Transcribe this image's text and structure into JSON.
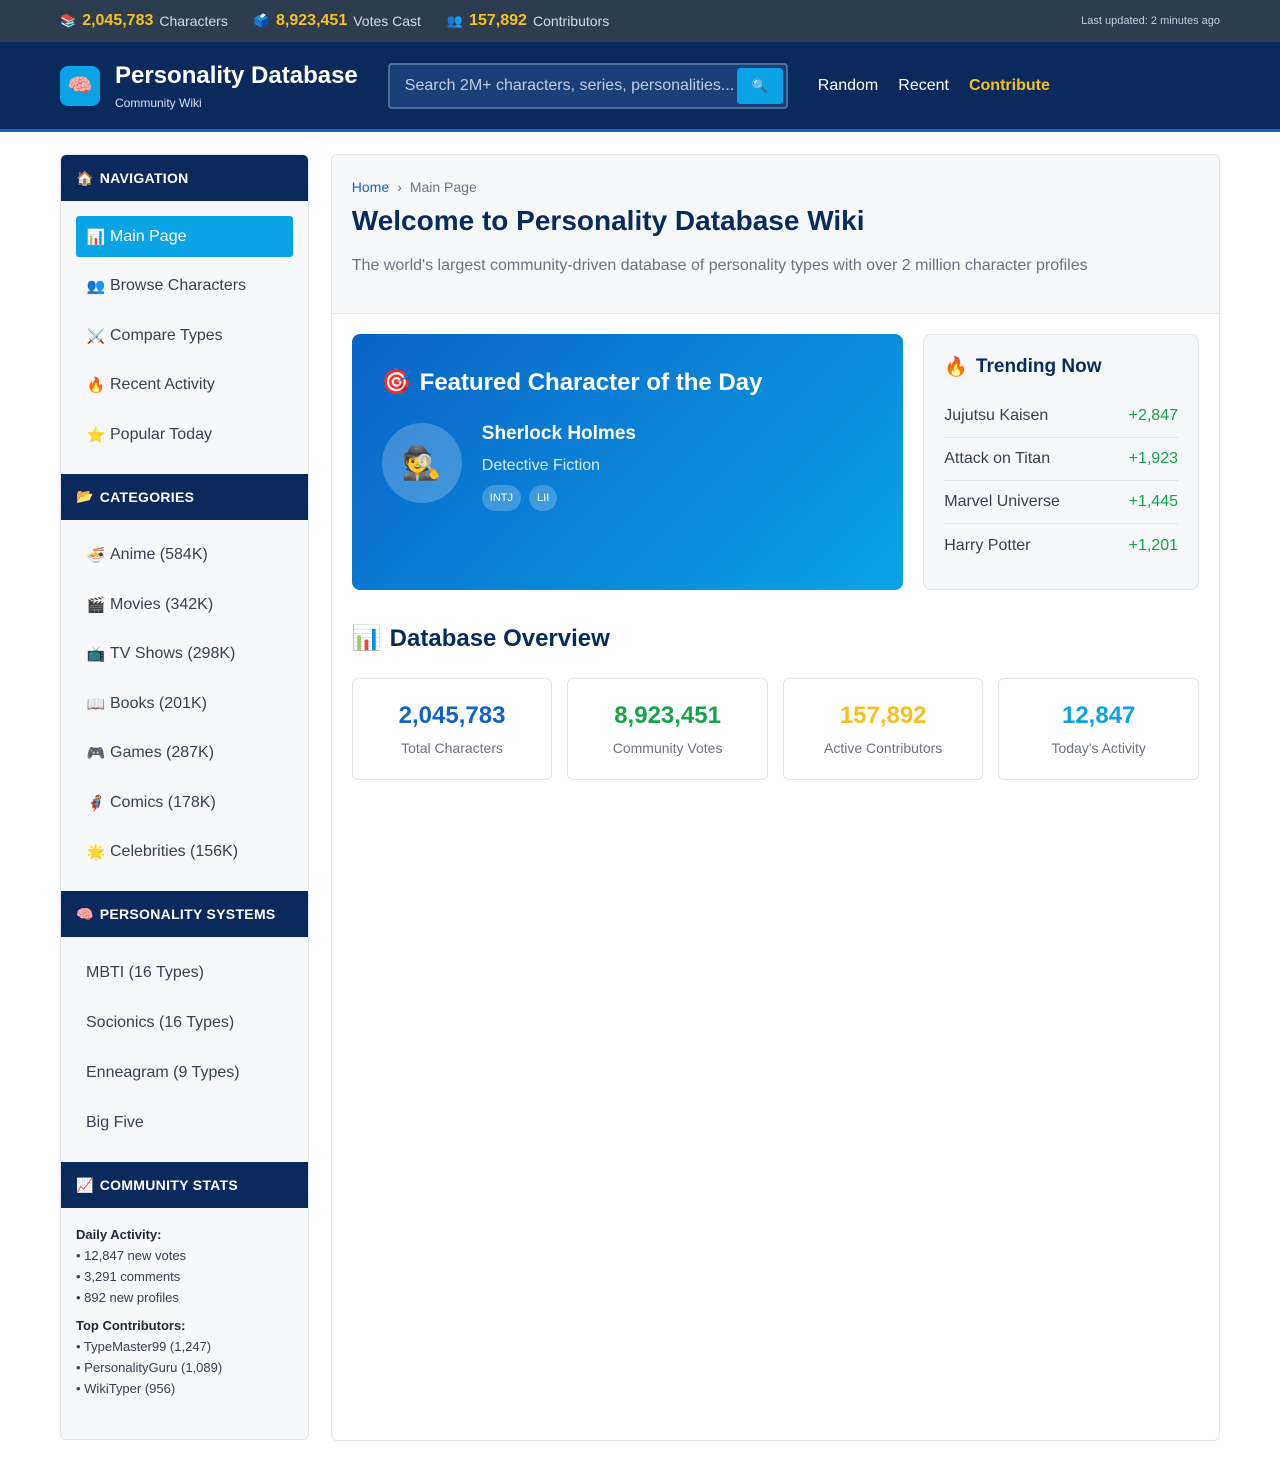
{
  "topbar": {
    "stats": [
      {
        "icon": "books-icon",
        "glyph": "📚",
        "value": "2,045,783",
        "label": "Characters"
      },
      {
        "icon": "ballot-box-icon",
        "glyph": "🗳️",
        "value": "8,923,451",
        "label": "Votes Cast"
      },
      {
        "icon": "people-icon",
        "glyph": "👥",
        "value": "157,892",
        "label": "Contributors"
      }
    ],
    "updated": "Last updated: 2 minutes ago"
  },
  "header": {
    "logo_glyph": "🧠",
    "title": "Personality Database",
    "subtitle": "Community Wiki",
    "search_placeholder": "Search 2M+ characters, series, personalities...",
    "search_button_glyph": "🔍",
    "nav": [
      "Random",
      "Recent",
      "Contribute"
    ]
  },
  "sidebar": {
    "navigation": {
      "title": "NAVIGATION",
      "glyph": "🏠",
      "items": [
        {
          "glyph": "📊",
          "label": "Main Page"
        },
        {
          "glyph": "👥",
          "label": "Browse Characters"
        },
        {
          "glyph": "⚔️",
          "label": "Compare Types"
        },
        {
          "glyph": "🔥",
          "label": "Recent Activity"
        },
        {
          "glyph": "⭐",
          "label": "Popular Today"
        }
      ]
    },
    "categories": {
      "title": "CATEGORIES",
      "glyph": "📂",
      "items": [
        {
          "glyph": "🍜",
          "label": "Anime (584K)"
        },
        {
          "glyph": "🎬",
          "label": "Movies (342K)"
        },
        {
          "glyph": "📺",
          "label": "TV Shows (298K)"
        },
        {
          "glyph": "📖",
          "label": "Books (201K)"
        },
        {
          "glyph": "🎮",
          "label": "Games (287K)"
        },
        {
          "glyph": "🦸",
          "label": "Comics (178K)"
        },
        {
          "glyph": "🌟",
          "label": "Celebrities (156K)"
        }
      ]
    },
    "systems": {
      "title": "PERSONALITY SYSTEMS",
      "glyph": "🧠",
      "items": [
        "MBTI (16 Types)",
        "Socionics (16 Types)",
        "Enneagram (9 Types)",
        "Big Five"
      ]
    },
    "community": {
      "title": "COMMUNITY STATS",
      "glyph": "📈",
      "daily_label": "Daily Activity:",
      "daily": [
        "• 12,847 new votes",
        "• 3,291 comments",
        "• 892 new profiles"
      ],
      "contrib_label": "Top Contributors:",
      "contributors": [
        "• TypeMaster99 (1,247)",
        "• PersonalityGuru (1,089)",
        "• WikiTyper (956)"
      ]
    }
  },
  "main": {
    "breadcrumb": {
      "home": "Home",
      "sep": "›",
      "current": "Main Page"
    },
    "title": "Welcome to Personality Database Wiki",
    "description": "The world's largest community-driven database of personality types with over 2 million character profiles",
    "featured": {
      "glyph": "🎯",
      "title": "Featured Character of the Day",
      "avatar_glyph": "🕵️",
      "name": "Sherlock Holmes",
      "series": "Detective Fiction",
      "badges": [
        "INTJ",
        "LII"
      ]
    },
    "trending": {
      "glyph": "🔥",
      "title": "Trending Now",
      "items": [
        {
          "name": "Jujutsu Kaisen",
          "delta": "+2,847"
        },
        {
          "name": "Attack on Titan",
          "delta": "+1,923"
        },
        {
          "name": "Marvel Universe",
          "delta": "+1,445"
        },
        {
          "name": "Harry Potter",
          "delta": "+1,201"
        }
      ]
    },
    "overview": {
      "glyph": "📊",
      "title": "Database Overview",
      "cards": [
        {
          "value": "2,045,783",
          "label": "Total Characters",
          "color": "#1363c6"
        },
        {
          "value": "8,923,451",
          "label": "Community Votes",
          "color": "#16a34a"
        },
        {
          "value": "157,892",
          "label": "Active Contributors",
          "color": "#f5c021"
        },
        {
          "value": "12,847",
          "label": "Today's Activity",
          "color": "#0aa4e6"
        }
      ]
    }
  },
  "colors": {
    "navy": "#0a2a5e",
    "accent": "#0aa4e6",
    "gold": "#f5c021",
    "positive": "#16a34a"
  }
}
